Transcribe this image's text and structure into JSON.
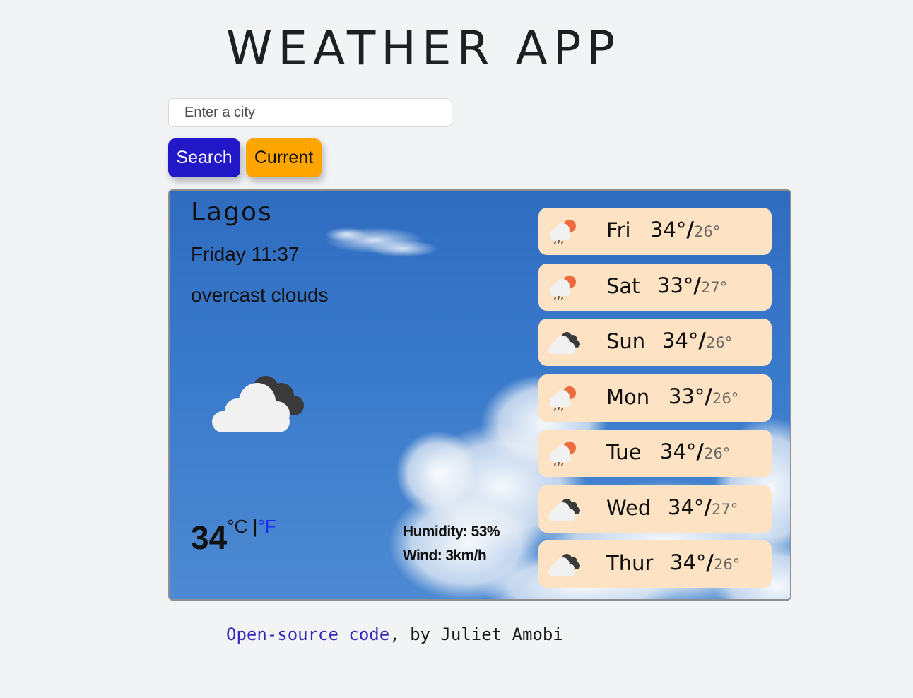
{
  "header": {
    "title": "WEATHER APP"
  },
  "search": {
    "placeholder": "Enter a city",
    "value": "",
    "search_label": "Search",
    "current_label": "Current"
  },
  "current": {
    "city": "Lagos",
    "date_time": "Friday 11:37",
    "description": "overcast clouds",
    "icon": "broken-clouds-icon",
    "temperature": "34",
    "unit_c": "°C",
    "unit_sep": " |",
    "unit_f": "°F",
    "humidity": "Humidity: 53%",
    "wind": "Wind: 3km/h"
  },
  "forecast": [
    {
      "day": "Fri",
      "max": "34°",
      "min": "26°",
      "icon": "rain-sun-icon"
    },
    {
      "day": "Sat",
      "max": "33°",
      "min": "27°",
      "icon": "rain-sun-icon"
    },
    {
      "day": "Sun",
      "max": "34°",
      "min": "26°",
      "icon": "broken-clouds-icon"
    },
    {
      "day": "Mon",
      "max": "33°",
      "min": "26°",
      "icon": "rain-sun-icon"
    },
    {
      "day": "Tue",
      "max": "34°",
      "min": "26°",
      "icon": "rain-sun-icon"
    },
    {
      "day": "Wed",
      "max": "34°",
      "min": "27°",
      "icon": "broken-clouds-icon"
    },
    {
      "day": "Thur",
      "max": "34°",
      "min": "26°",
      "icon": "broken-clouds-icon"
    }
  ],
  "footer": {
    "link_text": "Open-source code",
    "by_text": ", by Juliet Amobi"
  },
  "colors": {
    "background": "#f2f3f5",
    "search_button": "#2318c8",
    "current_button": "#ffa500",
    "forecast_card": "#fde3c4",
    "link": "#3328b8",
    "fahrenheit_link": "#1b2cf0"
  }
}
